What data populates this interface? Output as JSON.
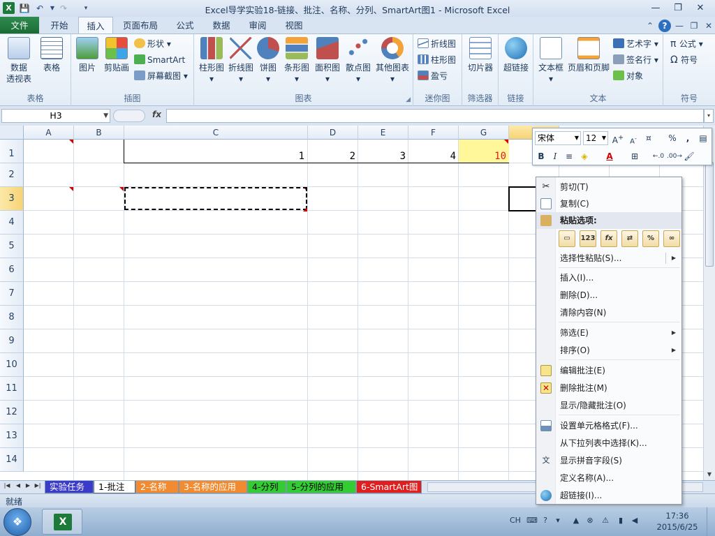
{
  "window": {
    "title": "Excel导学实验18-链接、批注、名称、分列、SmartArt图1  -  Microsoft Excel",
    "app_icon": "X"
  },
  "ribbon_tabs": [
    "文件",
    "开始",
    "插入",
    "页面布局",
    "公式",
    "数据",
    "审阅",
    "视图"
  ],
  "active_tab": "插入",
  "ribbon": {
    "table": {
      "pivot_line1": "数据",
      "pivot_line2": "透视表",
      "table": "表格",
      "group": "表格"
    },
    "illustrations": {
      "picture": "图片",
      "clipart": "剪贴画",
      "shapes": "形状",
      "smartart": "SmartArt",
      "screenshot": "屏幕截图",
      "group": "插图"
    },
    "charts": {
      "column": "柱形图",
      "line": "折线图",
      "pie": "饼图",
      "bar": "条形图",
      "area": "面积图",
      "scatter": "散点图",
      "other": "其他图表",
      "group": "图表"
    },
    "sparklines": {
      "line": "折线图",
      "column": "柱形图",
      "winloss": "盈亏",
      "group": "迷你图"
    },
    "filter": {
      "slicer": "切片器",
      "group": "筛选器"
    },
    "links": {
      "hyperlink": "超链接",
      "group": "链接"
    },
    "text": {
      "textbox": "文本框",
      "header_footer": "页眉和页脚",
      "wordart": "艺术字",
      "signature": "签名行",
      "object": "对象",
      "group": "文本"
    },
    "symbols": {
      "equation": "公式",
      "symbol": "符号",
      "group": "符号"
    }
  },
  "formula_bar": {
    "name_box": "H3",
    "fx": "fx",
    "value": ""
  },
  "sheet": {
    "columns": [
      "A",
      "B",
      "C",
      "D",
      "E",
      "F",
      "G"
    ],
    "rows": [
      "1",
      "2",
      "3",
      "4",
      "5",
      "6",
      "7",
      "8",
      "9",
      "10",
      "11",
      "12",
      "13",
      "14"
    ],
    "cells": {
      "C1": "1",
      "D1": "2",
      "E1": "3",
      "F1": "4",
      "G1": "10"
    },
    "selected_cell": "H3",
    "highlight_fill": "#fff799",
    "comment_indicator_color": "#d40000"
  },
  "sheet_tabs": [
    {
      "label": "实验任务",
      "color": "#3a3acb",
      "text_color": "#ffffff"
    },
    {
      "label": "1-批注",
      "color": "#ffffff",
      "text_color": "#000000"
    },
    {
      "label": "2-名称",
      "color": "#f28a30",
      "text_color": "#ffffff"
    },
    {
      "label": "3-名称的应用",
      "color": "#f28a30",
      "text_color": "#ffffff"
    },
    {
      "label": "4-分列",
      "color": "#33cc33",
      "text_color": "#000000"
    },
    {
      "label": "5-分列的应用",
      "color": "#33cc33",
      "text_color": "#000000"
    },
    {
      "label": "6-SmartArt图",
      "color": "#e01e1e",
      "text_color": "#ffffff"
    }
  ],
  "status": {
    "ready": "就绪"
  },
  "mini_toolbar": {
    "font": "宋体",
    "size": "12"
  },
  "context_menu": {
    "cut": "剪切(T)",
    "copy": "复制(C)",
    "paste_options": "粘贴选项:",
    "paste_special": "选择性粘贴(S)...",
    "insert": "插入(I)...",
    "delete": "删除(D)...",
    "clear": "清除内容(N)",
    "filter": "筛选(E)",
    "sort": "排序(O)",
    "edit_comment": "编辑批注(E)",
    "delete_comment": "删除批注(M)",
    "show_hide_comment": "显示/隐藏批注(O)",
    "format_cells": "设置单元格格式(F)...",
    "pick_from_list": "从下拉列表中选择(K)...",
    "phonetic": "显示拼音字段(S)",
    "define_name": "定义名称(A)...",
    "hyperlink": "超链接(I)...",
    "paste_icon_values": "123",
    "paste_icon_formula": "fx",
    "paste_icon_percent": "%"
  },
  "taskbar": {
    "lang": "CH",
    "time": "17:36",
    "date": "2015/6/25"
  }
}
